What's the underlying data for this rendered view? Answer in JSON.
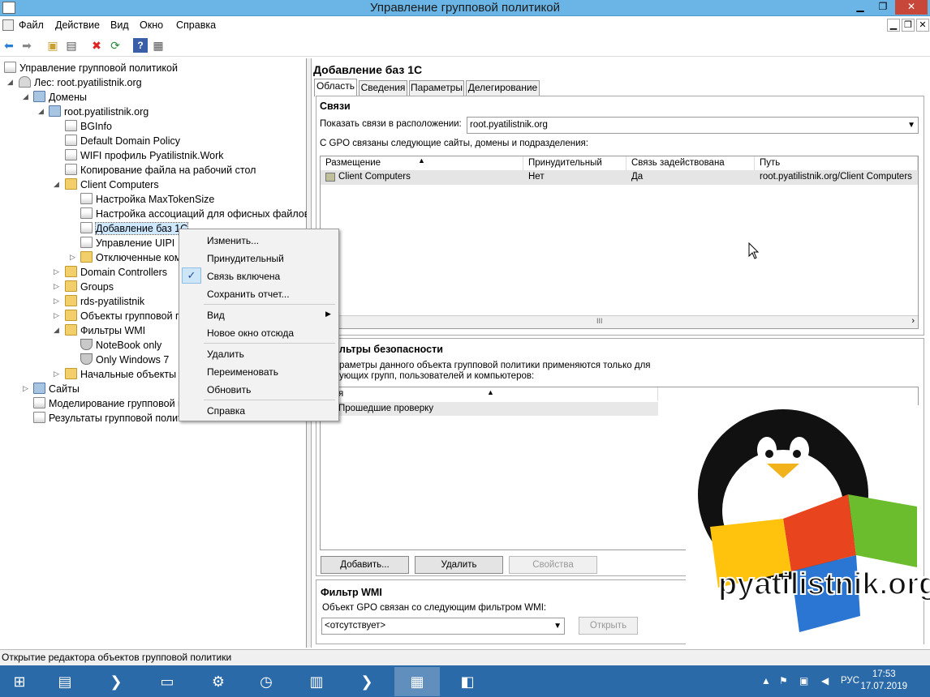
{
  "window": {
    "title": "Управление групповой политикой"
  },
  "menubar": {
    "items": [
      "Файл",
      "Действие",
      "Вид",
      "Окно",
      "Справка"
    ]
  },
  "tree": {
    "root": "Управление групповой политикой",
    "forest": "Лес: root.pyatilistnik.org",
    "domains": "Домены",
    "domain": "root.pyatilistnik.org",
    "items": [
      "BGInfo",
      "Default Domain Policy",
      "WIFI профиль Pyatilistnik.Work",
      "Копирование файла на рабочий стол"
    ],
    "client_computers": "Client Computers",
    "cc_children": [
      "Настройка MaxTokenSize",
      "Настройка ассоциаций для офисных файлов",
      "Добавление баз 1С",
      "Управление UIPI",
      "Отключенные ком"
    ],
    "folders": [
      "Domain Controllers",
      "Groups",
      "rds-pyatilistnik",
      "Объекты групповой п"
    ],
    "wmi": "Фильтры WMI",
    "wmi_children": [
      "NoteBook only",
      "Only Windows 7"
    ],
    "starter": "Начальные объекты г",
    "sites": "Сайты",
    "modeling": "Моделирование групповой п",
    "results": "Результаты групповой полит"
  },
  "context_menu": {
    "items": [
      "Изменить...",
      "Принудительный",
      "Связь включена",
      "Сохранить отчет...",
      "Вид",
      "Новое окно отсюда",
      "Удалить",
      "Переименовать",
      "Обновить",
      "Справка"
    ],
    "check": "✓"
  },
  "details": {
    "title": "Добавление баз 1С",
    "tabs": [
      "Область",
      "Сведения",
      "Параметры",
      "Делегирование"
    ],
    "links": {
      "title": "Связи",
      "show_label": "Показать связи в расположении:",
      "location": "root.pyatilistnik.org",
      "desc": "С GPO связаны следующие сайты, домены и подразделения:",
      "columns": [
        "Размещение",
        "Принудительный",
        "Связь задействована",
        "Путь"
      ],
      "rows": [
        [
          "Client Computers",
          "Нет",
          "Да",
          "root.pyatilistnik.org/Client Computers"
        ]
      ]
    },
    "security": {
      "title": "льтры безопасности",
      "desc1": "раметры данного объекта групповой политики применяются только для",
      "desc2": "ующих групп, пользователей и компьютеров:",
      "column": "я",
      "rows": [
        "Прошедшие проверку"
      ],
      "buttons": [
        "Добавить...",
        "Удалить",
        "Свойства"
      ]
    },
    "wmi": {
      "title": "Фильтр WMI",
      "desc": "Объект GPO связан со следующим фильтром WMI:",
      "value": "<отсутствует>",
      "open": "Открыть"
    }
  },
  "status": {
    "text": "Открытие редактора объектов групповой политики"
  },
  "taskbar": {
    "lang": "РУС",
    "time": "17:53",
    "date": "17.07.2019"
  },
  "logo": {
    "text": "pyatilistnik.org"
  }
}
